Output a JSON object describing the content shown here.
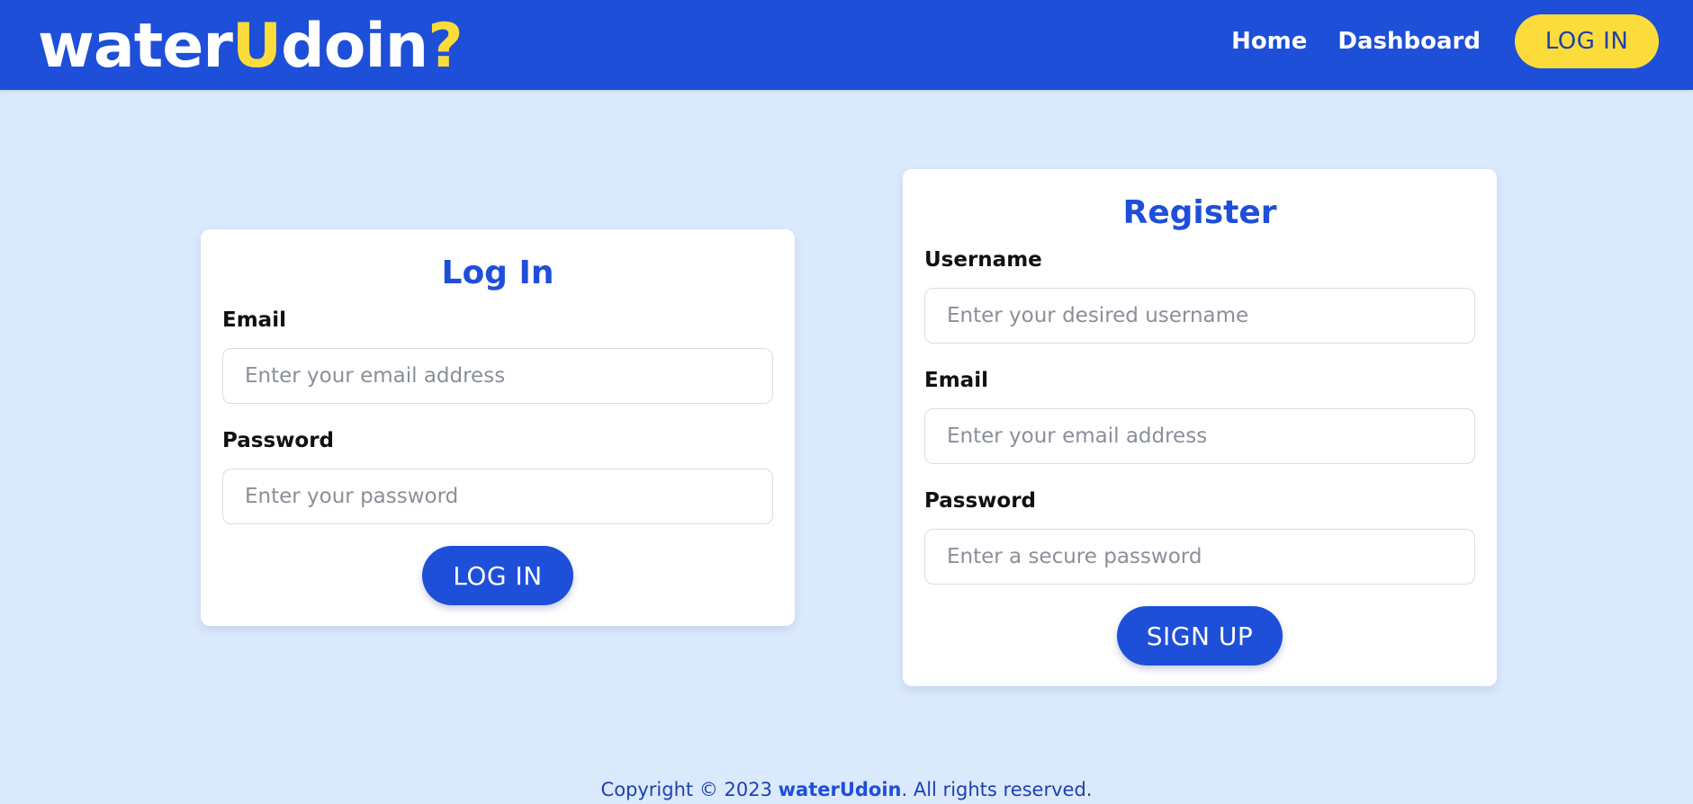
{
  "app": {
    "logo_part1": "water",
    "logo_accent1": "U",
    "logo_part2": "doin",
    "logo_accent2": "?"
  },
  "nav": {
    "home": "Home",
    "dashboard": "Dashboard",
    "login_button": "LOG IN"
  },
  "login_form": {
    "title": "Log In",
    "email_label": "Email",
    "email_placeholder": "Enter your email address",
    "password_label": "Password",
    "password_placeholder": "Enter your password",
    "submit_label": "LOG IN"
  },
  "register_form": {
    "title": "Register",
    "username_label": "Username",
    "username_placeholder": "Enter your desired username",
    "email_label": "Email",
    "email_placeholder": "Enter your email address",
    "password_label": "Password",
    "password_placeholder": "Enter a secure password",
    "submit_label": "SIGN UP"
  },
  "footer": {
    "prefix": "Copyright © 2023 ",
    "brand": "waterUdoin",
    "suffix": ". All rights reserved."
  },
  "colors": {
    "primary": "#1e4fd8",
    "accent": "#fcdc3b",
    "background": "#dbe9fd",
    "card": "#ffffff"
  }
}
